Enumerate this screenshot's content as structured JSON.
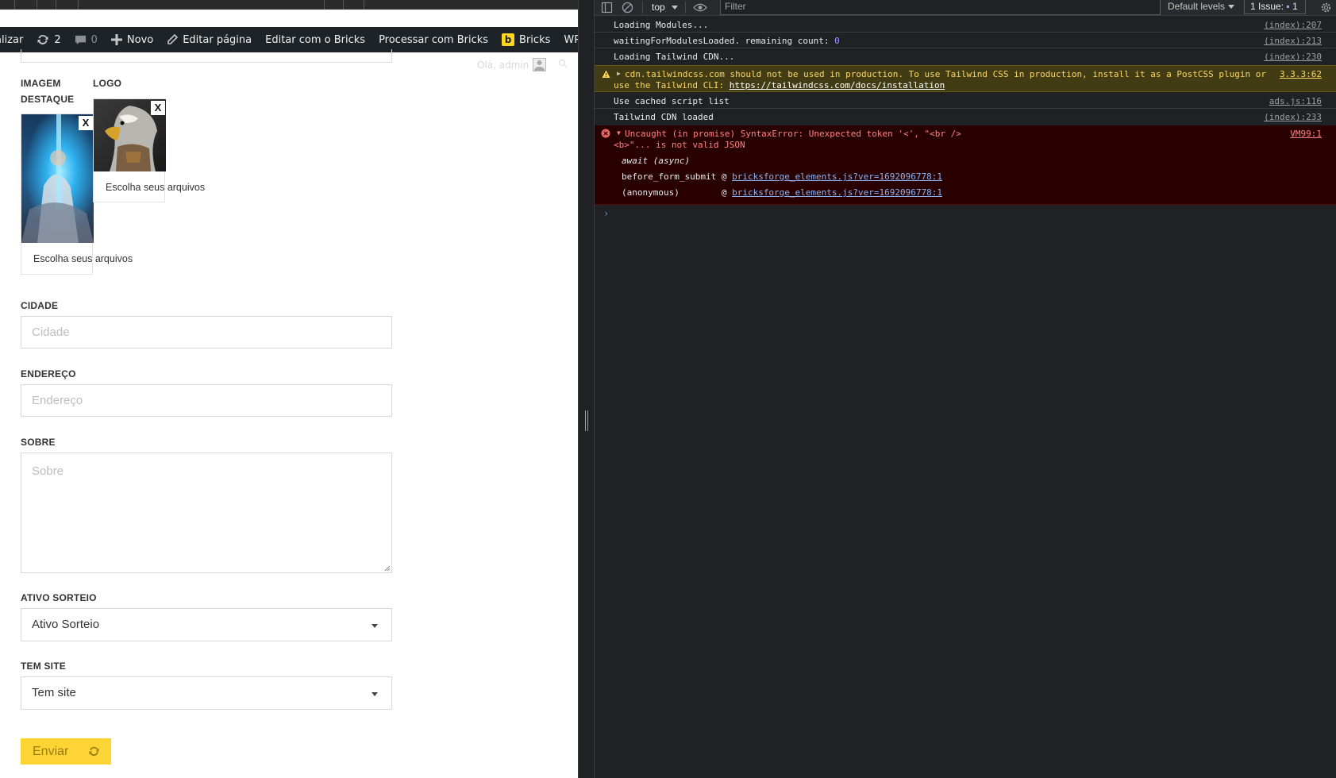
{
  "admin_bar": {
    "update_label": "alizar",
    "updates_count": "2",
    "comments_count": "0",
    "new_label": "Novo",
    "edit_page_label": "Editar página",
    "edit_bricks_label": "Editar com o Bricks",
    "process_bricks_label": "Processar com Bricks",
    "bricks_label": "Bricks",
    "wpcode_label": "WPCode"
  },
  "greeting": "Olá, admin",
  "form": {
    "featured_image_label_line1": "IMAGEM",
    "featured_image_label_line2": "DESTAQUE",
    "logo_label": "LOGO",
    "remove_label": "X",
    "choose_files_label": "Escolha seus arquivos",
    "city_label": "CIDADE",
    "city_placeholder": "Cidade",
    "address_label": "ENDEREÇO",
    "address_placeholder": "Endereço",
    "about_label": "SOBRE",
    "about_placeholder": "Sobre",
    "raffle_label": "ATIVO SORTEIO",
    "raffle_value": "Ativo Sorteio",
    "site_label": "TEM SITE",
    "site_value": "Tem site",
    "submit_label": "Enviar"
  },
  "devtools": {
    "context": "top",
    "filter_placeholder": "Filter",
    "levels": "Default levels",
    "issues_label": "1 Issue:",
    "issues_count": "1",
    "messages": [
      {
        "text": "Loading Modules...",
        "source": "(index):207"
      },
      {
        "text_prefix": "waitingForModulesLoaded. remaining count: ",
        "count": "0",
        "source": "(index):213"
      },
      {
        "text": "Loading Tailwind CDN...",
        "source": "(index):230"
      },
      {
        "line1": "cdn.tailwindcss.com should not be used in production. To use Tailwind CSS in production, install it as a PostCSS plugin or",
        "line2_prefix": "use the Tailwind CLI: ",
        "link": "https://tailwindcss.com/docs/installation",
        "source": "3.3.3:62"
      },
      {
        "text": "Use cached script list",
        "source": "ads.js:116"
      },
      {
        "text": "Tailwind CDN loaded",
        "source": "(index):233"
      },
      {
        "line1": "Uncaught (in promise) SyntaxError: Unexpected token '<', \"<br />",
        "line2": "<b>\"... is not valid JSON",
        "source": "VM99:1",
        "stack0": "await (async)",
        "stack1_fn": "before_form_submit @ ",
        "stack1_link": "bricksforge_elements.js?ver=1692096778:1",
        "stack2_fn": "(anonymous)        @ ",
        "stack2_link": "bricksforge_elements.js?ver=1692096778:1"
      }
    ],
    "prompt": "›"
  },
  "colors": {
    "admin_bar_bg": "#1d2327",
    "button_yellow": "#fcd535",
    "devtools_bg": "#202124",
    "warning_bg": "#413c14",
    "error_bg": "#290000"
  }
}
